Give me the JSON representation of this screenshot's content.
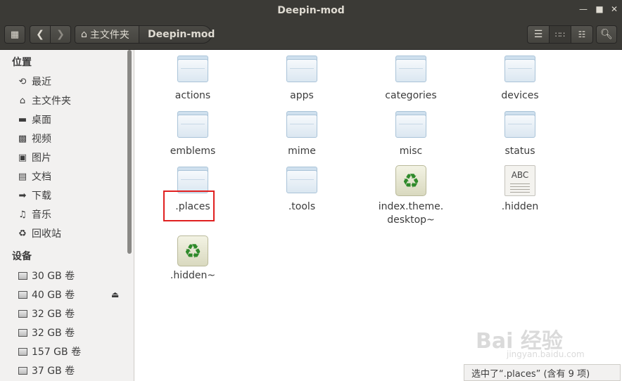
{
  "window": {
    "title": "Deepin-mod"
  },
  "toolbar": {
    "breadcrumb_home": "主文件夹",
    "breadcrumb_current": "Deepin-mod"
  },
  "sidebar": {
    "places_heading": "位置",
    "places": [
      {
        "label": "最近",
        "icon": "recent-icon"
      },
      {
        "label": "主文件夹",
        "icon": "home-icon"
      },
      {
        "label": "桌面",
        "icon": "desktop-icon"
      },
      {
        "label": "视频",
        "icon": "video-icon"
      },
      {
        "label": "图片",
        "icon": "picture-icon"
      },
      {
        "label": "文档",
        "icon": "document-icon"
      },
      {
        "label": "下载",
        "icon": "download-icon"
      },
      {
        "label": "音乐",
        "icon": "music-icon"
      },
      {
        "label": "回收站",
        "icon": "trash-icon"
      }
    ],
    "devices_heading": "设备",
    "devices": [
      {
        "label": "30 GB 卷"
      },
      {
        "label": "40 GB 卷"
      },
      {
        "label": "32 GB 卷"
      },
      {
        "label": "32 GB 卷"
      },
      {
        "label": "157 GB 卷"
      },
      {
        "label": "37 GB 卷"
      }
    ]
  },
  "files": [
    {
      "name": "actions",
      "type": "folder"
    },
    {
      "name": "apps",
      "type": "folder"
    },
    {
      "name": "categories",
      "type": "folder"
    },
    {
      "name": "devices",
      "type": "folder"
    },
    {
      "name": "emblems",
      "type": "folder"
    },
    {
      "name": "mime",
      "type": "folder"
    },
    {
      "name": "misc",
      "type": "folder"
    },
    {
      "name": "status",
      "type": "folder"
    },
    {
      "name": ".places",
      "type": "folder"
    },
    {
      "name": ".tools",
      "type": "folder"
    },
    {
      "name": "index.theme.",
      "name_line2": "desktop~",
      "type": "recycle"
    },
    {
      "name": ".hidden",
      "type": "text",
      "icon_text": "ABC"
    },
    {
      "name": ".hidden~",
      "type": "recycle"
    }
  ],
  "status": "选中了“.places” (含有 9 项)",
  "watermark": {
    "main": "Bai 经验",
    "sub": "jingyan.baidu.com"
  },
  "colors": {
    "titlebar": "#3b3a36",
    "sidebar": "#f2f1f0",
    "highlight": "#e02020"
  }
}
